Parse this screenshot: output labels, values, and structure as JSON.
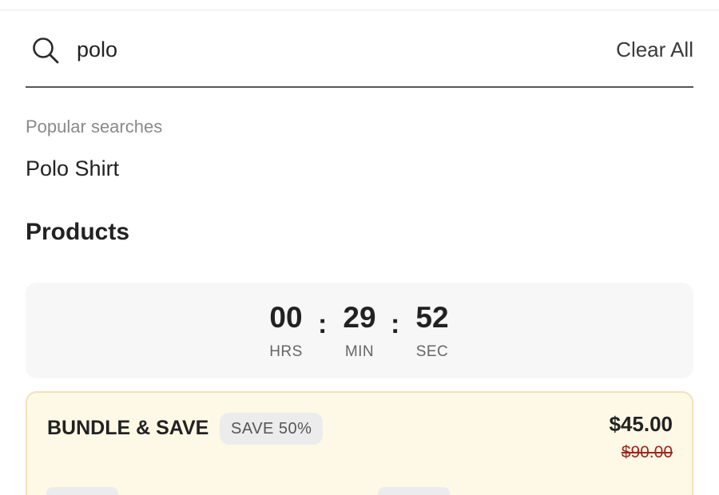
{
  "search": {
    "query": "polo",
    "clear_label": "Clear All"
  },
  "popular": {
    "heading": "Popular searches",
    "items": [
      "Polo Shirt"
    ]
  },
  "products": {
    "heading": "Products"
  },
  "countdown": {
    "hours": "00",
    "hours_label": "HRS",
    "minutes": "29",
    "minutes_label": "MIN",
    "seconds": "52",
    "seconds_label": "SEC",
    "separator": ":"
  },
  "bundle": {
    "title": "BUNDLE & SAVE",
    "badge": "SAVE 50%",
    "price": "$45.00",
    "original_price": "$90.00",
    "background_color": "#fdf9e6",
    "strike_color": "#a3231c"
  },
  "icons": {
    "search": "search-icon"
  }
}
